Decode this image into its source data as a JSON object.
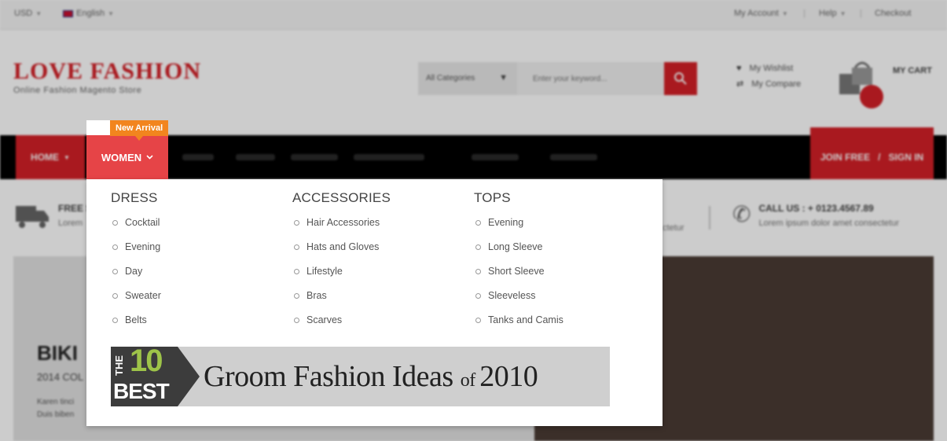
{
  "topbar": {
    "currency": "USD",
    "language": "English",
    "my_account": "My Account",
    "help": "Help",
    "checkout": "Checkout",
    "sep": "|"
  },
  "header": {
    "logo_title": "LOVE FASHION",
    "logo_sub": "Online Fashion Magento Store",
    "search_category": "All Categories",
    "search_placeholder": "Enter your keyword...",
    "wishlist": "My Wishlist",
    "compare": "My Compare",
    "cart": "MY CART"
  },
  "nav": {
    "home": "HOME",
    "women": "WOMEN",
    "badge": "New Arrival",
    "join": "JOIN FREE",
    "slash": "/",
    "signin": "SIGN IN"
  },
  "policy": {
    "shipping_title": "FREE S",
    "shipping_desc": "Lorem",
    "call_title": "CALL US : + 0123.4567.89",
    "call_desc": "Lorem ipsum dolor amet consectetur",
    "mid_desc": "ctetur"
  },
  "banner": {
    "title": "BIKI",
    "sub": "2014 COL",
    "line1": "Karen tinci",
    "line2": "Duis biben"
  },
  "mega_menu": {
    "columns": [
      {
        "title": "DRESS",
        "items": [
          "Cocktail",
          "Evening",
          "Day",
          "Sweater",
          "Belts"
        ]
      },
      {
        "title": "ACCESSORIES",
        "items": [
          "Hair Accessories",
          "Hats and Gloves",
          "Lifestyle",
          "Bras",
          "Scarves"
        ]
      },
      {
        "title": "TOPS",
        "items": [
          "Evening",
          "Long Sleeve",
          "Short Sleeve",
          "Sleeveless",
          "Tanks and Camis"
        ]
      }
    ],
    "promo": {
      "the": "THE",
      "ten": "10",
      "best": "BEST",
      "text_main": "Groom Fashion Ideas ",
      "text_of": "of ",
      "text_year": "2010"
    }
  },
  "colors": {
    "brand_red": "#d42027",
    "active_tab": "#e64447",
    "badge_orange": "#f2851e",
    "promo_green": "#9ec449"
  }
}
